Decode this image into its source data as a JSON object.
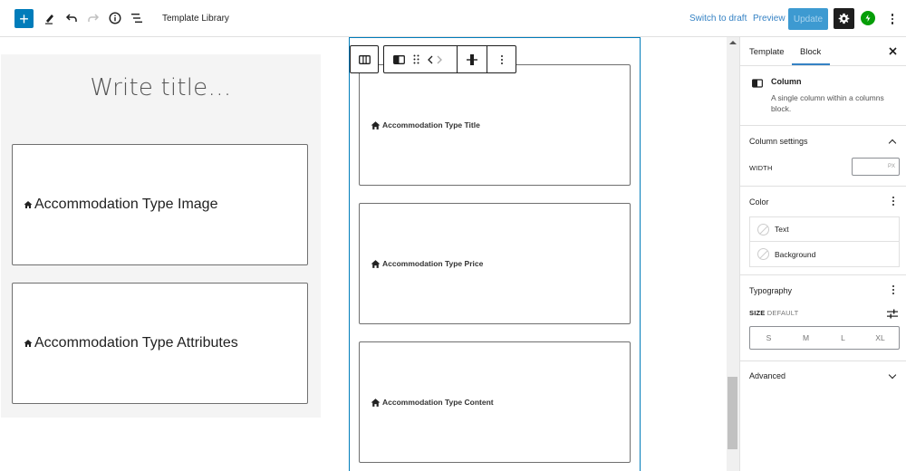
{
  "topbar": {
    "document_title": "Template Library",
    "switch_to_draft": "Switch to draft",
    "preview": "Preview",
    "update": "Update",
    "icons": [
      "plus-icon",
      "pencil-icon",
      "undo-icon",
      "redo-icon",
      "info-icon",
      "list-view-icon",
      "gear-icon",
      "jetpack-icon",
      "more-vertical-icon"
    ]
  },
  "canvas": {
    "title_placeholder": "Write title…",
    "left_column_blocks": [
      {
        "label": "Accommodation Type Image"
      },
      {
        "label": "Accommodation Type Attributes"
      }
    ],
    "right_column_blocks": [
      {
        "label": "Accommodation Type Title"
      },
      {
        "label": "Accommodation Type Price"
      },
      {
        "label": "Accommodation Type Content"
      }
    ]
  },
  "block_toolbar": {
    "items": [
      "select-parent-columns",
      "column-block-type",
      "drag-handle",
      "move-left",
      "move-right",
      "vertical-alignment",
      "more-options"
    ]
  },
  "sidebar": {
    "tabs": [
      {
        "label": "Template",
        "active": false
      },
      {
        "label": "Block",
        "active": true
      }
    ],
    "block_card": {
      "title": "Column",
      "description": "A single column within a columns block."
    },
    "column_settings": {
      "title": "Column settings",
      "width_label": "WIDTH",
      "width_value": "",
      "width_unit": "PX"
    },
    "color": {
      "title": "Color",
      "items": [
        {
          "label": "Text"
        },
        {
          "label": "Background"
        }
      ]
    },
    "typography": {
      "title": "Typography",
      "size_label": "SIZE",
      "size_value": "DEFAULT",
      "sizes": [
        "S",
        "M",
        "L",
        "XL"
      ]
    },
    "advanced": {
      "title": "Advanced"
    }
  },
  "colors": {
    "accent": "#007cba",
    "link": "#3582c4",
    "update_button": "#3d9ad1",
    "jetpack": "#069e08",
    "canvas_gray": "#f4f4f4"
  }
}
